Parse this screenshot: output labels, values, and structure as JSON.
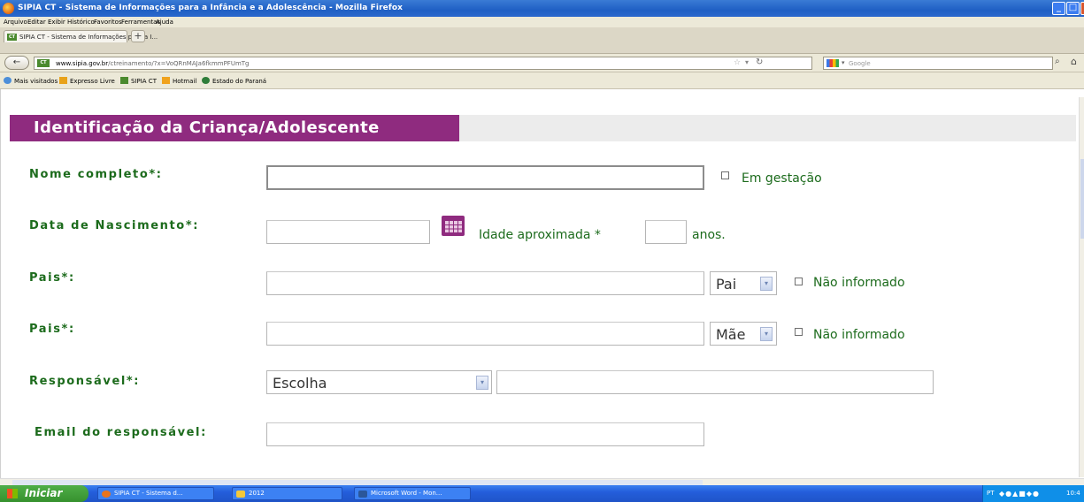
{
  "window": {
    "title": "SIPIA CT - Sistema de Informações para a Infância e a Adolescência - Mozilla Firefox",
    "buttons": {
      "minimize": "_",
      "maximize": "□",
      "close": "x"
    }
  },
  "menu": [
    "Arquivo",
    "Editar",
    "Exibir",
    "Histórico",
    "Favoritos",
    "Ferramentas",
    "Ajuda"
  ],
  "tab": {
    "label": "SIPIA CT - Sistema de Informações para a I...",
    "new_tab": "+"
  },
  "nav": {
    "back": "←",
    "url_domain": "www.sipia.gov.br",
    "url_path": "/ctreinamento/?x=VoQRnMAJa6fkmmPFUmTg",
    "search_placeholder": "Google",
    "home": "⌂"
  },
  "bookmarks": [
    "Mais visitados",
    "Expresso Livre",
    "SIPIA CT",
    "Hotmail",
    "Estado do Paraná"
  ],
  "form": {
    "section_title": "Identificação da Criança/Adolescente",
    "nome_label": "Nome completo*:",
    "em_gestacao_label": "Em gestação",
    "data_nascimento_label": "Data de Nascimento*:",
    "idade_label": "Idade aproximada *",
    "anos_label": "anos.",
    "pais1_label": "Pais*:",
    "pais1_select": "Pai",
    "nao_informado_1": "Não informado",
    "pais2_label": "Pais*:",
    "pais2_select": "Mãe",
    "nao_informado_2": "Não informado",
    "responsavel_label": "Responsável*:",
    "responsavel_select": "Escolha",
    "email_label": "Email do responsável:"
  },
  "taskbar": {
    "start": "Iniciar",
    "buttons": [
      "SIPIA CT - Sistema d...",
      "2012",
      "Microsoft Word - Mon..."
    ],
    "lang": "PT",
    "clock": "10:4"
  },
  "colors": {
    "accent_purple": "#8f2b7f",
    "label_green": "#1c6b1c",
    "titlebar_blue": "#245edb"
  }
}
